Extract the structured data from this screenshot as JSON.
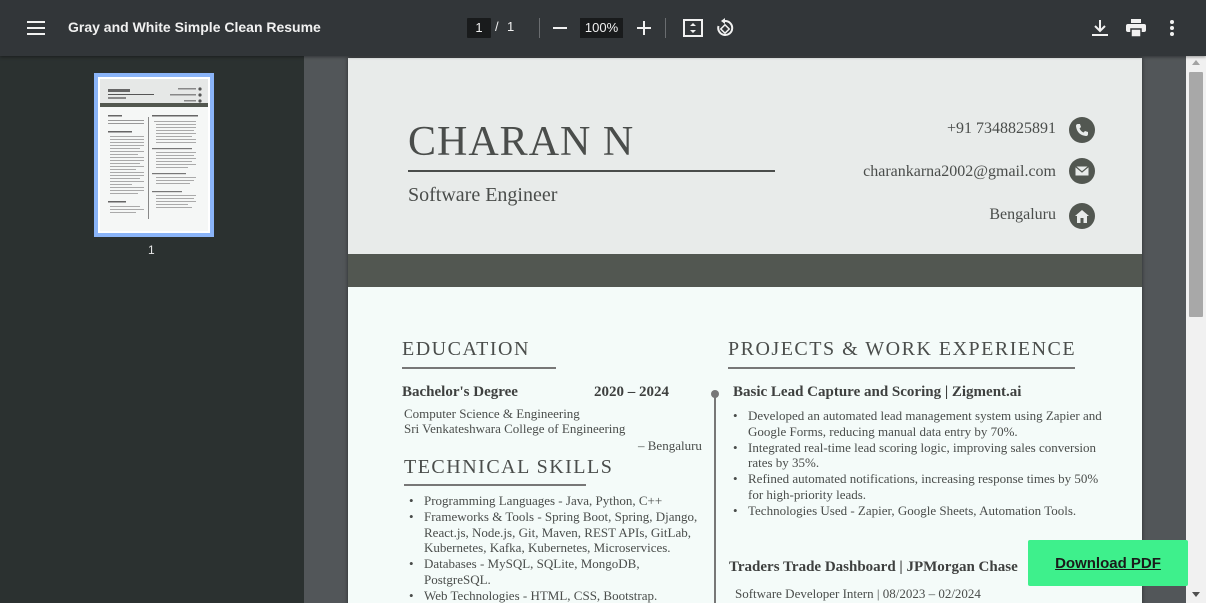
{
  "toolbar": {
    "title": "Gray and White Simple Clean Resume",
    "current_page": "1",
    "page_separator": "/",
    "total_pages": "1",
    "zoom": "100%"
  },
  "sidebar": {
    "thumbnail_label": "1"
  },
  "resume": {
    "name": "CHARAN N",
    "role": "Software Engineer",
    "phone": "+91 7348825891",
    "email": "charankarna2002@gmail.com",
    "location": "Bengaluru",
    "education": {
      "heading": "EDUCATION",
      "degree": "Bachelor's Degree",
      "years": "2020 – 2024",
      "field": "Computer Science & Engineering",
      "college": "Sri Venkateshwara College of Engineering",
      "place": "– Bengaluru"
    },
    "skills": {
      "heading": "TECHNICAL SKILLS",
      "items": [
        "Programming Languages - Java, Python, C++",
        "Frameworks & Tools - Spring Boot, Spring, Django, React.js, Node.js, Git, Maven, REST APIs, GitLab, Kubernetes, Kafka, Kubernetes, Microservices.",
        "Databases - MySQL, SQLite, MongoDB, PostgreSQL.",
        "Web Technologies - HTML, CSS, Bootstrap."
      ]
    },
    "projects": {
      "heading": "PROJECTS & WORK EXPERIENCE",
      "p1_title": "Basic Lead Capture and Scoring | Zigment.ai",
      "p1_items": [
        "Developed an automated lead management system using Zapier and Google Forms, reducing manual data entry by 70%.",
        "Integrated real-time lead scoring logic, improving sales conversion rates by 35%.",
        "Refined automated notifications, increasing response times by 50% for high-priority leads.",
        "Technologies Used - Zapier, Google Sheets, Automation Tools."
      ],
      "p2_title": "Traders Trade Dashboard | JPMorgan Chase",
      "p2_sub": "Software Developer Intern |  08/2023 – 02/2024"
    }
  },
  "download_button": "Download PDF",
  "colors": {
    "toolbar_bg": "#323639",
    "viewer_bg": "#525659",
    "header_band": "#525751",
    "accent_green": "#3ef08c",
    "thumb_border": "#8ab4f8"
  }
}
